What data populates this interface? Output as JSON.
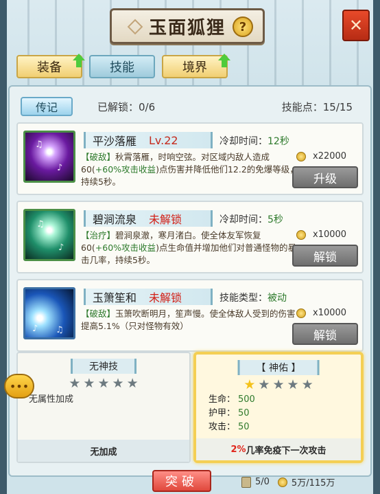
{
  "title": "玉面狐狸",
  "help_glyph": "?",
  "close_glyph": "✕",
  "tabs": [
    {
      "label": "装备",
      "upgrade": true
    },
    {
      "label": "技能",
      "upgrade": false,
      "active": true
    },
    {
      "label": "境界",
      "upgrade": true
    }
  ],
  "header": {
    "legend_label": "传记",
    "unlocked_text": "已解锁：0/6",
    "skill_points_text": "技能点：15/15"
  },
  "skills": [
    {
      "name": "平沙落雁",
      "status": "Lv.22",
      "meta_label": "冷却时间：",
      "meta_value": "12秒",
      "tag": "【破敌】",
      "desc_a": "秋霄落雁，时响空弦。对区域内敌人造成60(",
      "desc_hl": "+60%攻击收益",
      "desc_b": ")点伤害并降低他们12.2的免爆等级，持续5秒。",
      "cost": "x22000",
      "button": "升级"
    },
    {
      "name": "碧涧流泉",
      "status": "未解锁",
      "meta_label": "冷却时间：",
      "meta_value": "5秒",
      "tag": "【治疗】",
      "desc_a": "碧涧泉澈，寒月渚白。使全体友军恢复60(",
      "desc_hl": "+60%攻击收益",
      "desc_b": ")点生命值并增加他们对普通怪物的暴击几率，持续5秒。",
      "cost": "x10000",
      "button": "解锁"
    },
    {
      "name": "玉箫笙和",
      "status": "未解锁",
      "meta_label": "技能类型：",
      "meta_value": "被动",
      "tag": "【破敌】",
      "desc_a": "玉箫吹断明月，笙声慢。使全体敌人受到的伤害提高5.1%（只对怪物有效）",
      "desc_hl": "",
      "desc_b": "",
      "cost": "x10000",
      "button": "解锁"
    }
  ],
  "left_panel": {
    "title": "无神技",
    "stars_on": 0,
    "note": "无属性加成",
    "footer": "无加成"
  },
  "right_panel": {
    "title": "【 神佑 】",
    "stars_on": 1,
    "stats": [
      {
        "label": "生命：",
        "value": "500"
      },
      {
        "label": "护甲：",
        "value": "50"
      },
      {
        "label": "攻击：",
        "value": "50"
      }
    ],
    "footer_red": "2%",
    "footer_rest": "几率免疫下一次攻击"
  },
  "bottom": {
    "breakthrough": "突破",
    "scroll_count": "5/0",
    "money": "5万/115万"
  },
  "colors": {
    "accent_green": "#2e7a2c",
    "locked_red": "#d21f16",
    "gold_border": "#f4cf54"
  }
}
